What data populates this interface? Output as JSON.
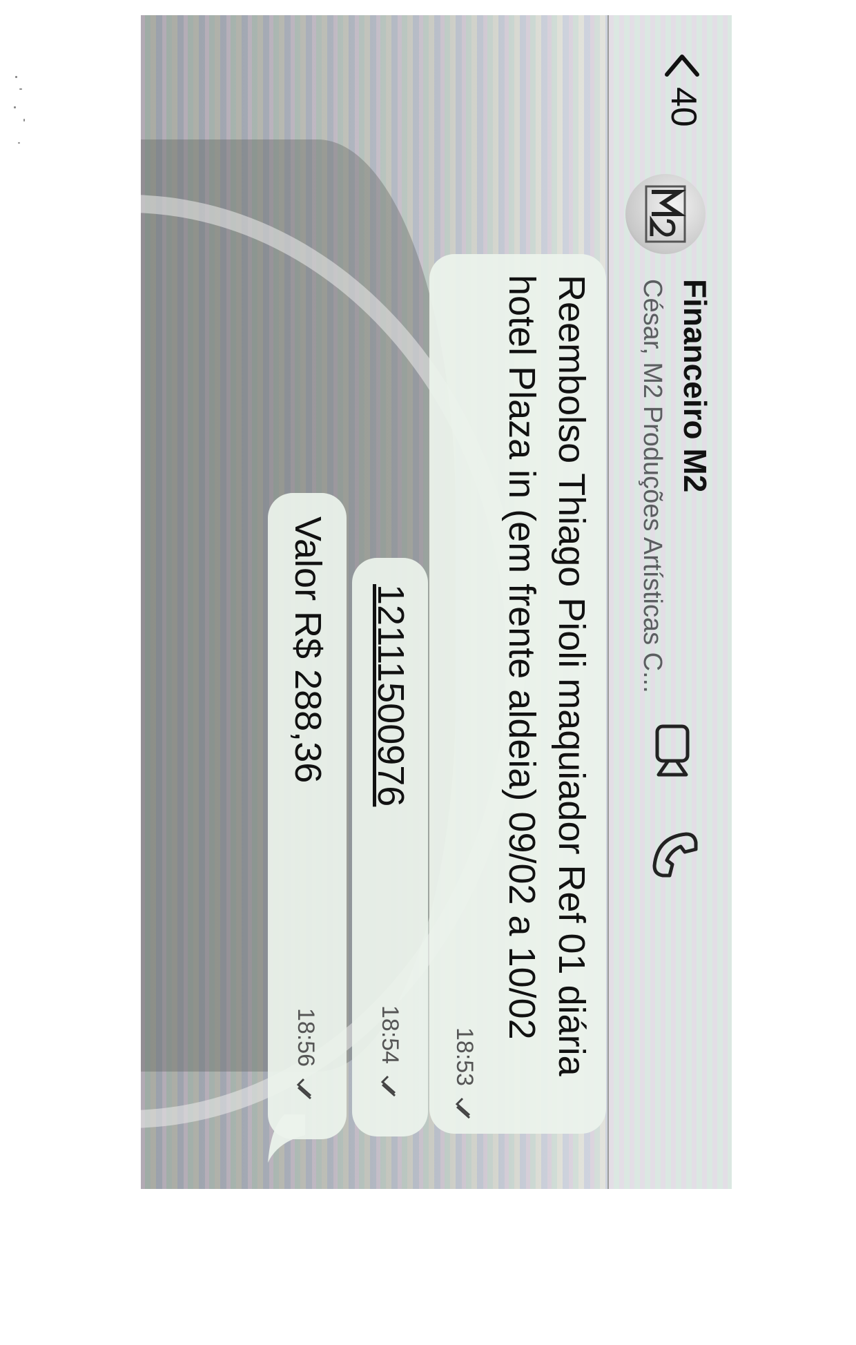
{
  "header": {
    "back_count": "40",
    "chat_title": "Financeiro M2",
    "chat_subtitle": "César, M2 Produções Artísticas C...",
    "avatar_logo_text": "M2"
  },
  "messages": [
    {
      "text": "Reembolso Thiago Pioli maquiador Ref 01 diária hotel Plaza in (em frente aldeia) 09/02 a 10/02",
      "time": "18:53",
      "status": "read"
    },
    {
      "text": "12111500976",
      "time": "18:54",
      "status": "read"
    },
    {
      "text": "Valor R$ 288,36",
      "time": "18:56",
      "status": "read"
    }
  ],
  "colors": {
    "bubble": "#ecf3ec",
    "header": "#e6e9e6",
    "text": "#111111",
    "subtext": "#5b5d60"
  },
  "icons": [
    "back-chevron-icon",
    "avatar-logo",
    "video-call-icon",
    "phone-call-icon",
    "double-check-icon"
  ]
}
